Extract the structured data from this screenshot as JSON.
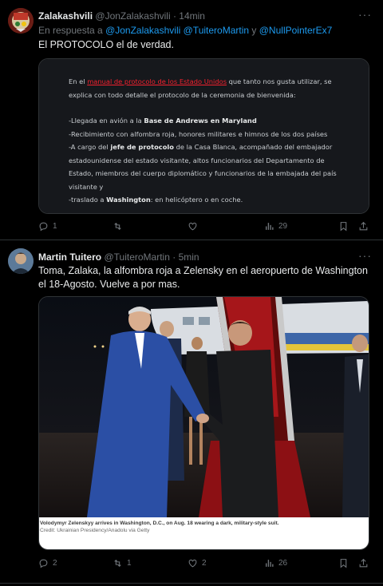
{
  "tweet1": {
    "display_name": "Zalakashvili",
    "handle": "@JonZalakashvili",
    "time": "14min",
    "reply_prefix": "En respuesta a",
    "reply_user1": "@JonZalakashvili",
    "reply_user2": "@TuiteroMartin",
    "reply_conj": "y",
    "reply_user3": "@NullPointerEx7",
    "text": "El PROTOCOLO el de verdad.",
    "quote": {
      "p1_a": "En el",
      "p1_link": "manual de protocolo de los Estado Unidos",
      "p1_b": "que tanto nos gusta utilizar, se",
      "p1_c": "explica con todo detalle el protocolo de la ceremonia de bienvenida:",
      "l1_a": "-Llegada en avión a la",
      "l1_b": "Base de Andrews en Maryland",
      "l2": "-Recibimiento con alfombra roja, honores militares e himnos de los dos países",
      "l3_a": "-A cargo del",
      "l3_b": "jefe de protocolo",
      "l3_c": "de la Casa Blanca,  acompañado del embajador",
      "l4": "estadounidense del estado visitante, altos funcionarios del Departamento de",
      "l5": "Estado, miembros del cuerpo diplomático y funcionarios de la embajada del país",
      "l6": "visitante y",
      "l7_a": "-traslado a",
      "l7_b": "Washington",
      "l7_c": ": en helicóptero o en coche."
    },
    "actions": {
      "replies": "1",
      "retweets": "",
      "likes": "",
      "views": "29"
    }
  },
  "tweet2": {
    "display_name": "Martin Tuitero",
    "handle": "@TuiteroMartin",
    "time": "5min",
    "text": "Toma, Zalaka, la alfombra roja a Zelensky en el aeropuerto de Washington el 18-Agosto. Vuelve a por mas.",
    "caption_main": "Volodymyr Zelenskyy arrives in Washington, D.C., on Aug. 18 wearing a dark, military-style suit.",
    "caption_credit": "Credit: Ukrainian Presidency/Anadolu via Getty",
    "actions": {
      "replies": "2",
      "retweets": "1",
      "likes": "2",
      "views": "26"
    }
  },
  "sep": "·",
  "icons": [
    "more-icon",
    "reply-icon",
    "retweet-icon",
    "like-icon",
    "views-icon",
    "bookmark-icon",
    "share-icon"
  ],
  "colors": {
    "bg": "#000000",
    "text": "#e7e9ea",
    "muted": "#71767b",
    "link": "#1d9bf0",
    "quote_link": "#f4212e"
  }
}
